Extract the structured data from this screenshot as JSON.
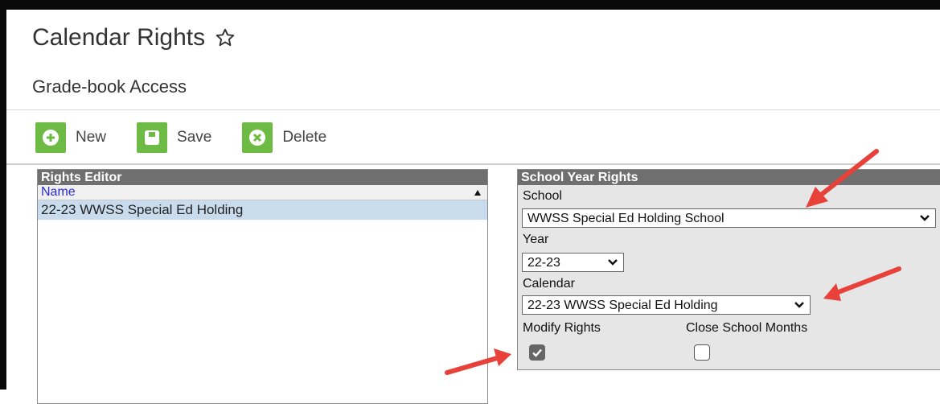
{
  "page": {
    "title": "Calendar Rights",
    "subtitle": "Grade-book Access"
  },
  "toolbar": {
    "new_label": "New",
    "save_label": "Save",
    "delete_label": "Delete",
    "accent_color": "#6dbb45"
  },
  "rights_editor": {
    "header": "Rights Editor",
    "column": "Name",
    "rows": [
      "22-23 WWSS Special Ed Holding"
    ]
  },
  "school_year_rights": {
    "header": "School Year Rights",
    "school_label": "School",
    "school_value": "WWSS Special Ed Holding School",
    "year_label": "Year",
    "year_value": "22-23",
    "calendar_label": "Calendar",
    "calendar_value": "22-23 WWSS Special Ed Holding",
    "modify_rights_label": "Modify Rights",
    "modify_rights_checked": true,
    "close_months_label": "Close School Months",
    "close_months_checked": false
  },
  "annotations": {
    "arrow_color": "#e8413a"
  }
}
